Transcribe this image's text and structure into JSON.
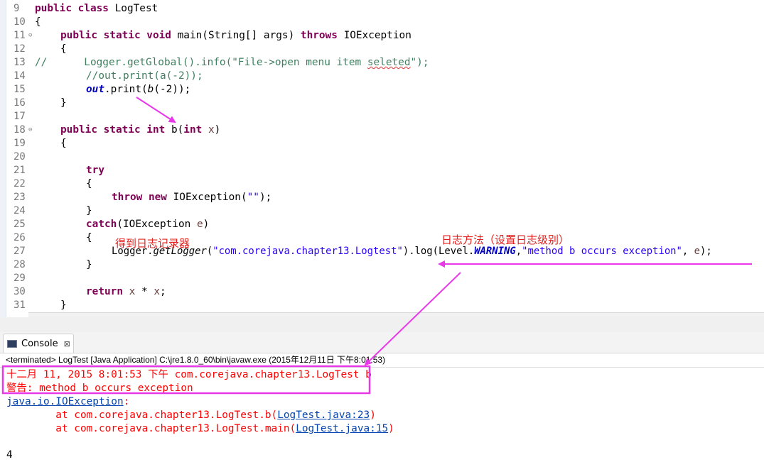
{
  "editor": {
    "line_numbers": [
      "9",
      "10",
      "11",
      "12",
      "13",
      "14",
      "15",
      "16",
      "17",
      "18",
      "19",
      "20",
      "21",
      "22",
      "23",
      "24",
      "25",
      "26",
      "27",
      "28",
      "29",
      "30",
      "31"
    ],
    "fold_markers": [
      "⊖",
      "⊖"
    ],
    "lines": {
      "l9_kw": "public class ",
      "l9_name": "LogTest",
      "l10": "{",
      "l11_kw1": "public static void ",
      "l11_mid": "main(String[] args) ",
      "l11_kw2": "throws ",
      "l11_tail": "IOException",
      "l12": "{",
      "l13_cmt_a": "//      Logger.getGlobal().info(\"File->open menu item ",
      "l13_cmt_b": "seleted",
      "l13_cmt_c": "\");",
      "l14_cmt": "//out.print(a(-2));",
      "l15_fld": "out",
      "l15_a": ".print(",
      "l15_st": "b",
      "l15_b": "(-2));",
      "l16": "}",
      "l18_kw1": "public static int ",
      "l18_b": "b(",
      "l18_kw2": "int ",
      "l18_var": "x",
      "l18_c": ")",
      "l19": "{",
      "l21_kw": "try",
      "l22": "{",
      "l23_kw": "throw new ",
      "l23_a": "IOException(",
      "l23_str": "\"\"",
      "l23_b": ");",
      "l24": "}",
      "l25_kw": "catch",
      "l25_a": "(IOException ",
      "l25_var": "e",
      "l25_b": ")",
      "l26": "{",
      "l27_a": "Logger.",
      "l27_st": "getLogger",
      "l27_b": "(",
      "l27_str1": "\"com.corejava.chapter13.Logtest\"",
      "l27_c": ").log(Level.",
      "l27_fld": "WARNING",
      "l27_d": ",",
      "l27_str2": "\"method b occurs exception\"",
      "l27_e": ", ",
      "l27_var": "e",
      "l27_f": ");",
      "l28": "}",
      "l30_kw": "return ",
      "l30_var1": "x",
      "l30_mid": " * ",
      "l30_var2": "x",
      "l30_end": ";",
      "l31": "}"
    }
  },
  "annotations": {
    "get_logger_note": "得到日志记录器",
    "log_method_note": "日志方法（设置日志级别）"
  },
  "console": {
    "tab_label": "Console",
    "tab_close": "⊠",
    "status": "<terminated> LogTest [Java Application] C:\\jre1.8.0_60\\bin\\javaw.exe (2015年12月11日 下午8:01:53)",
    "log_line1": "十二月 11, 2015 8:01:53 下午 com.corejava.chapter13.LogTest b",
    "log_line2": "警告: method b occurs exception",
    "exception": "java.io.IOException",
    "exception_colon": ":",
    "trace": [
      {
        "prefix": "        at com.corejava.chapter13.LogTest.b(",
        "link": "LogTest.java:23",
        "suffix": ")"
      },
      {
        "prefix": "        at com.corejava.chapter13.LogTest.main(",
        "link": "LogTest.java:15",
        "suffix": ")"
      }
    ],
    "result": "4"
  },
  "colors": {
    "keyword": "#7f0055",
    "comment": "#3f7f5f",
    "string": "#2a00ff",
    "field": "#0000c0",
    "error_output": "#ff0000",
    "annotation": "#e0201e",
    "arrow": "#e838e8"
  }
}
